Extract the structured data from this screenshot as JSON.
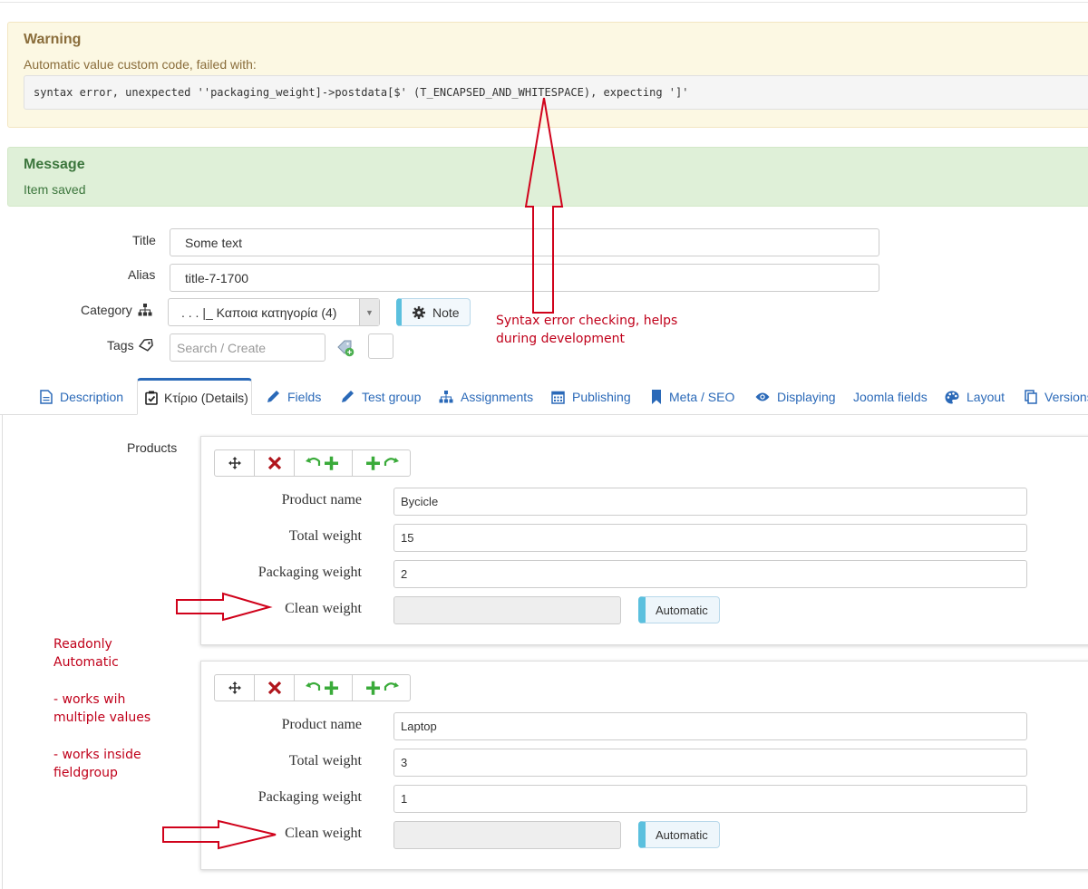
{
  "warning": {
    "heading": "Warning",
    "text": "Automatic value custom code, failed with:",
    "code": "syntax error, unexpected ''packaging_weight]->postdata[$' (T_ENCAPSED_AND_WHITESPACE), expecting ']'"
  },
  "message": {
    "heading": "Message",
    "text": "Item saved"
  },
  "form": {
    "title_label": "Title",
    "title_value": "Some text",
    "alias_label": "Alias",
    "alias_value": "title-7-1700",
    "category_label": "Category",
    "category_value": ". . . |_ Καποια κατηγορία (4)",
    "note_label": "Note",
    "tags_label": "Tags",
    "tags_placeholder": "Search / Create"
  },
  "tabs": [
    {
      "label": "Description",
      "icon": "document-icon"
    },
    {
      "label": "Κτίριο (Details)",
      "icon": "checklist-icon",
      "active": true
    },
    {
      "label": "Fields",
      "icon": "pencil-icon"
    },
    {
      "label": "Test group",
      "icon": "pencil-icon"
    },
    {
      "label": "Assignments",
      "icon": "sitemap-icon"
    },
    {
      "label": "Publishing",
      "icon": "calendar-icon"
    },
    {
      "label": "Meta / SEO",
      "icon": "bookmark-icon"
    },
    {
      "label": "Displaying",
      "icon": "eye-icon"
    },
    {
      "label": "Joomla fields",
      "icon": ""
    },
    {
      "label": "Layout",
      "icon": "palette-icon"
    },
    {
      "label": "Versions",
      "icon": "copy-icon"
    }
  ],
  "products": {
    "label": "Products",
    "field_labels": {
      "product_name": "Product name",
      "total_weight": "Total weight",
      "packaging_weight": "Packaging weight",
      "clean_weight": "Clean weight"
    },
    "automatic_label": "Automatic",
    "items": [
      {
        "product_name": "Bycicle",
        "total_weight": "15",
        "packaging_weight": "2",
        "clean_weight": ""
      },
      {
        "product_name": "Laptop",
        "total_weight": "3",
        "packaging_weight": "1",
        "clean_weight": ""
      }
    ]
  },
  "annotations": {
    "syntax_note_line1": "Syntax error checking, helps",
    "syntax_note_line2": "during development",
    "side_line1": "Readonly",
    "side_line2": "Automatic",
    "side_line3": "- works wih",
    "side_line4": "multiple values",
    "side_line5": "- works inside",
    "side_line6": "fieldgroup"
  },
  "colors": {
    "tab_link": "#2a69b8",
    "warning_text": "#8a6d3b",
    "success_text": "#3c763d",
    "annotation": "#c0001a",
    "info_accent": "#5bc0de"
  }
}
